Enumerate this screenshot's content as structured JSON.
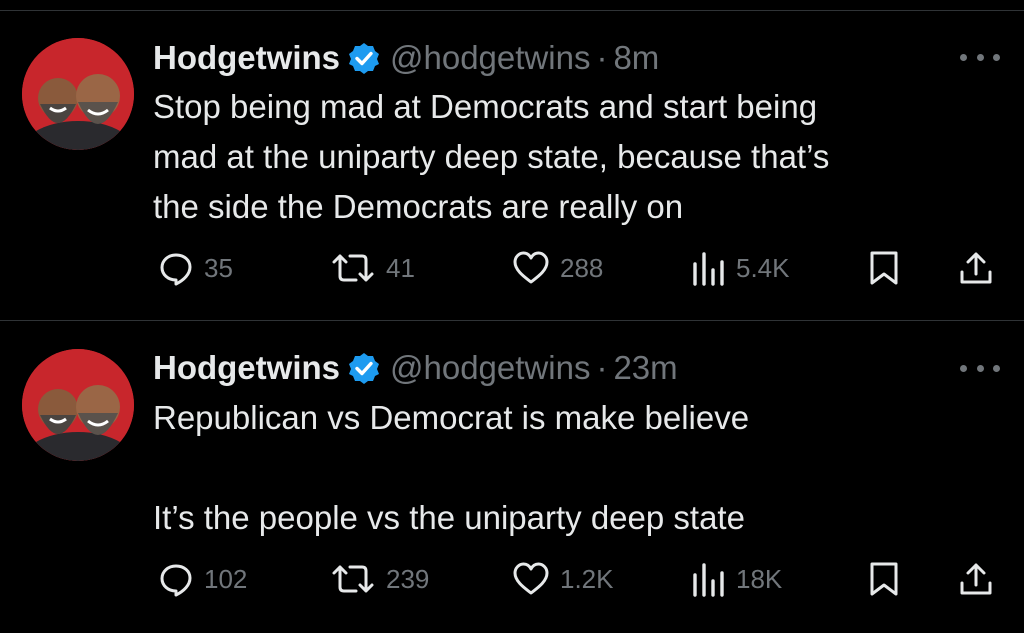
{
  "tweets": [
    {
      "author": "Hodgetwins",
      "handle": "@hodgetwins",
      "separator": "·",
      "time": "8m",
      "lines": [
        "Stop being mad at Democrats and start being",
        "mad at the uniparty deep state, because that’s",
        "the side the Democrats are really on"
      ],
      "stats": {
        "replies": "35",
        "reposts": "41",
        "likes": "288",
        "views": "5.4K"
      }
    },
    {
      "author": "Hodgetwins",
      "handle": "@hodgetwins",
      "separator": "·",
      "time": "23m",
      "lines": [
        "Republican vs Democrat is make believe",
        "",
        "It’s the people vs the uniparty deep state"
      ],
      "stats": {
        "replies": "102",
        "reposts": "239",
        "likes": "1.2K",
        "views": "18K"
      }
    }
  ],
  "icons": [
    "reply-icon",
    "repost-icon",
    "like-icon",
    "views-icon",
    "bookmark-icon",
    "share-icon",
    "verified-badge-icon",
    "more-icon"
  ],
  "colors": {
    "background": "#000000",
    "text": "#e7e9ea",
    "muted": "#71767b",
    "verified": "#1d9bf0",
    "avatar": "#c8262c",
    "divider": "#2f3336"
  }
}
